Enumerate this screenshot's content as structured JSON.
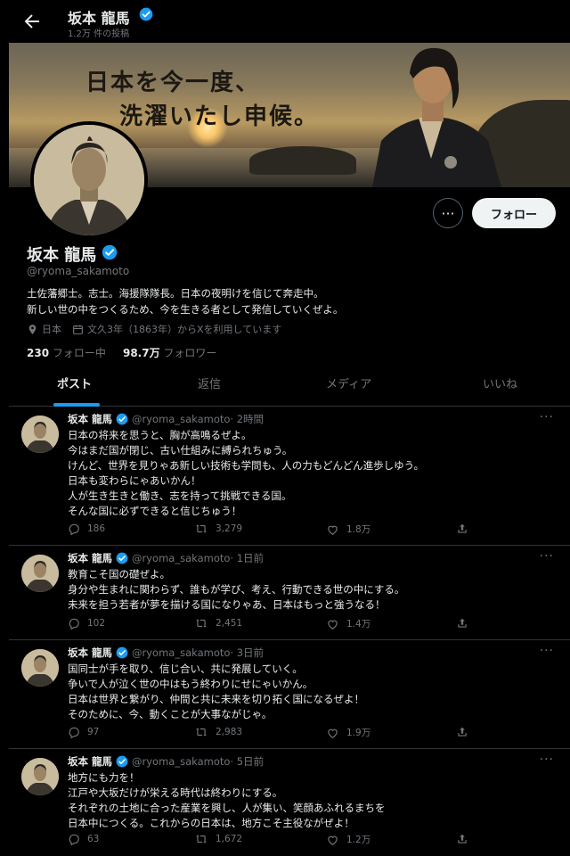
{
  "header": {
    "name": "坂本 龍馬",
    "post_count": "1.2万 件の投稿"
  },
  "banner": {
    "line1": "日本を今一度、",
    "line2": "洗濯いたし申候。"
  },
  "profile": {
    "name": "坂本 龍馬",
    "handle": "@ryoma_sakamoto",
    "bio_line1": "土佐藩郷士。志士。海援隊隊長。日本の夜明けを信じて奔走中。",
    "bio_line2": "新しい世の中をつくるため、今を生きる者として発信していくぜよ。",
    "location": "日本",
    "joined": "文久3年（1863年）からXを利用しています",
    "following_count": "230",
    "following_label": "フォロー中",
    "followers_count": "98.7万",
    "followers_label": "フォロワー",
    "follow_button": "フォロー",
    "more_button": "···"
  },
  "tabs": [
    "ポスト",
    "返信",
    "メディア",
    "いいね"
  ],
  "tweets": [
    {
      "name": "坂本 龍馬",
      "handle": "@ryoma_sakamoto",
      "time": "· 2時間",
      "lines": [
        "日本の将来を思うと、胸が高鳴るぜよ。",
        "今はまだ国が閉じ、古い仕組みに縛られちゅう。",
        "けんど、世界を見りゃあ新しい技術も学問も、人の力もどんどん進歩しゆう。",
        "日本も変わらにゃあいかん！",
        "人が生き生きと働き、志を持って挑戦できる国。",
        "そんな国に必ずできると信じちゅう！"
      ],
      "replies": "186",
      "reposts": "3,279",
      "likes": "1.8万"
    },
    {
      "name": "坂本 龍馬",
      "handle": "@ryoma_sakamoto",
      "time": "· 1日前",
      "lines": [
        "教育こそ国の礎ぜよ。",
        "身分や生まれに関わらず、誰もが学び、考え、行動できる世の中にする。",
        "未来を担う若者が夢を描ける国になりゃあ、日本はもっと強うなる！"
      ],
      "replies": "102",
      "reposts": "2,451",
      "likes": "1.4万"
    },
    {
      "name": "坂本 龍馬",
      "handle": "@ryoma_sakamoto",
      "time": "· 3日前",
      "lines": [
        "国同士が手を取り、信じ合い、共に発展していく。",
        "争いで人が泣く世の中はもう終わりにせにゃいかん。",
        "日本は世界と繋がり、仲間と共に未来を切り拓く国になるぜよ！",
        "そのために、今、動くことが大事ながじゃ。"
      ],
      "replies": "97",
      "reposts": "2,983",
      "likes": "1.9万"
    },
    {
      "name": "坂本 龍馬",
      "handle": "@ryoma_sakamoto",
      "time": "· 5日前",
      "lines": [
        "地方にも力を！",
        "江戸や大坂だけが栄える時代は終わりにする。",
        "それぞれの土地に合った産業を興し、人が集い、笑顔あふれるまちを",
        "日本中につくる。これからの日本は、地方こそ主役ながぜよ！"
      ],
      "replies": "63",
      "reposts": "1,672",
      "likes": "1.2万"
    }
  ],
  "colors": {
    "background": "#000000",
    "accent": "#1d9bf0",
    "text_primary": "#e7e9ea",
    "text_secondary": "#71767b",
    "border": "#2f3336"
  }
}
